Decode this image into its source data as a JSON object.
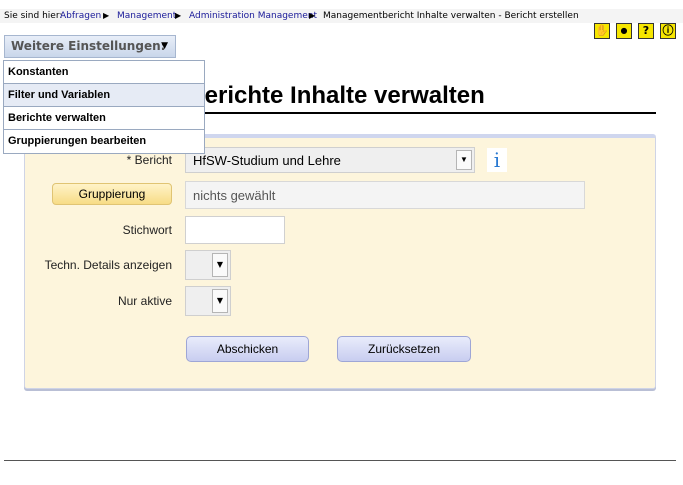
{
  "breadcrumb": {
    "prefix": "Sie sind hier:",
    "items": [
      "Abfragen",
      "Management",
      "Administration Management"
    ],
    "current": "Managementbericht Inhalte verwalten - Bericht erstellen",
    "separator": "▶"
  },
  "top_icons": [
    {
      "name": "hand-icon",
      "glyph": "✋"
    },
    {
      "name": "dot-icon",
      "glyph": "●"
    },
    {
      "name": "help-icon",
      "glyph": "?"
    },
    {
      "name": "info-circle-icon",
      "glyph": "ⓘ"
    }
  ],
  "settings": {
    "label": "Weitere Einstellungen:",
    "caret": "▼",
    "menu": [
      "Konstanten",
      "Filter und Variablen",
      "Berichte verwalten",
      "Gruppierungen bearbeiten"
    ]
  },
  "page_title": "berichte Inhalte verwalten",
  "form": {
    "bericht_label": "* Bericht",
    "bericht_value": "HfSW-Studium und Lehre",
    "info_glyph": "i",
    "gruppierung_button": "Gruppierung",
    "gruppierung_value": "nichts gewählt",
    "stichwort_label": "Stichwort",
    "stichwort_value": "",
    "techn_label": "Techn. Details anzeigen",
    "techn_value": "",
    "aktiv_label": "Nur aktive",
    "aktiv_value": "",
    "dropdown_glyph": "▼",
    "submit_label": "Abschicken",
    "reset_label": "Zurücksetzen"
  },
  "colors": {
    "panel_bg": "#fdf5dc",
    "link": "#1a1a99",
    "icon_yellow": "#f6e600"
  }
}
